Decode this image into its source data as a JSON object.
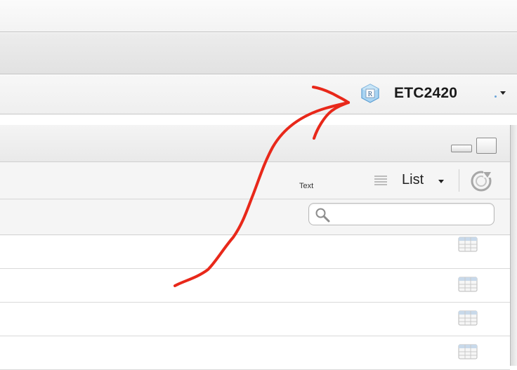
{
  "project": {
    "name": "ETC2420",
    "icon": "r-project-icon"
  },
  "pane": {
    "toolbar": {
      "text_label": "Text",
      "view_label": "List",
      "list_icon": "list-lines-icon",
      "refresh_icon": "refresh-icon"
    },
    "search": {
      "value": "",
      "placeholder": ""
    },
    "rows": [
      {
        "icon": "table-icon"
      },
      {
        "icon": "table-icon"
      },
      {
        "icon": "table-icon"
      },
      {
        "icon": "table-icon"
      }
    ]
  },
  "annotation": {
    "type": "hand-drawn arrow",
    "color": "#e8281a"
  },
  "colors": {
    "accent": "#e8281a",
    "r_icon_blue": "#6fb3e6"
  }
}
